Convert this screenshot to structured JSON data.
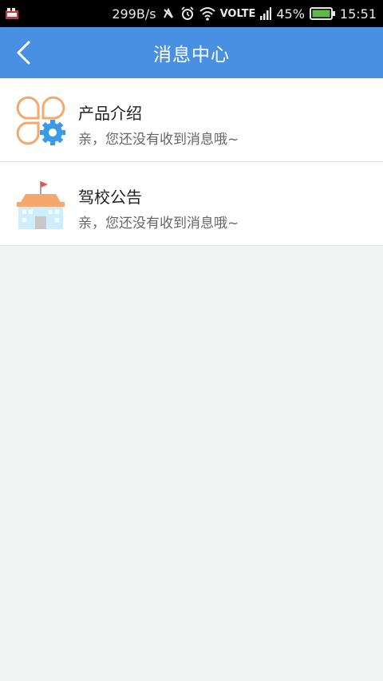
{
  "status_bar": {
    "speed": "299B/s",
    "network": "VOLTE",
    "battery": "45%",
    "time": "15:51",
    "icons": [
      "app-notification-icon",
      "data-sync-icon",
      "alarm-icon",
      "wifi-icon",
      "signal-icon",
      "battery-icon"
    ]
  },
  "header": {
    "title": "消息中心",
    "bg_color": "#4a90e2"
  },
  "messages": [
    {
      "title": "产品介绍",
      "subtitle": "亲，您还没有收到消息哦~",
      "icon": "product-intro-icon"
    },
    {
      "title": "驾校公告",
      "subtitle": "亲，您还没有收到消息哦~",
      "icon": "school-notice-icon"
    }
  ]
}
